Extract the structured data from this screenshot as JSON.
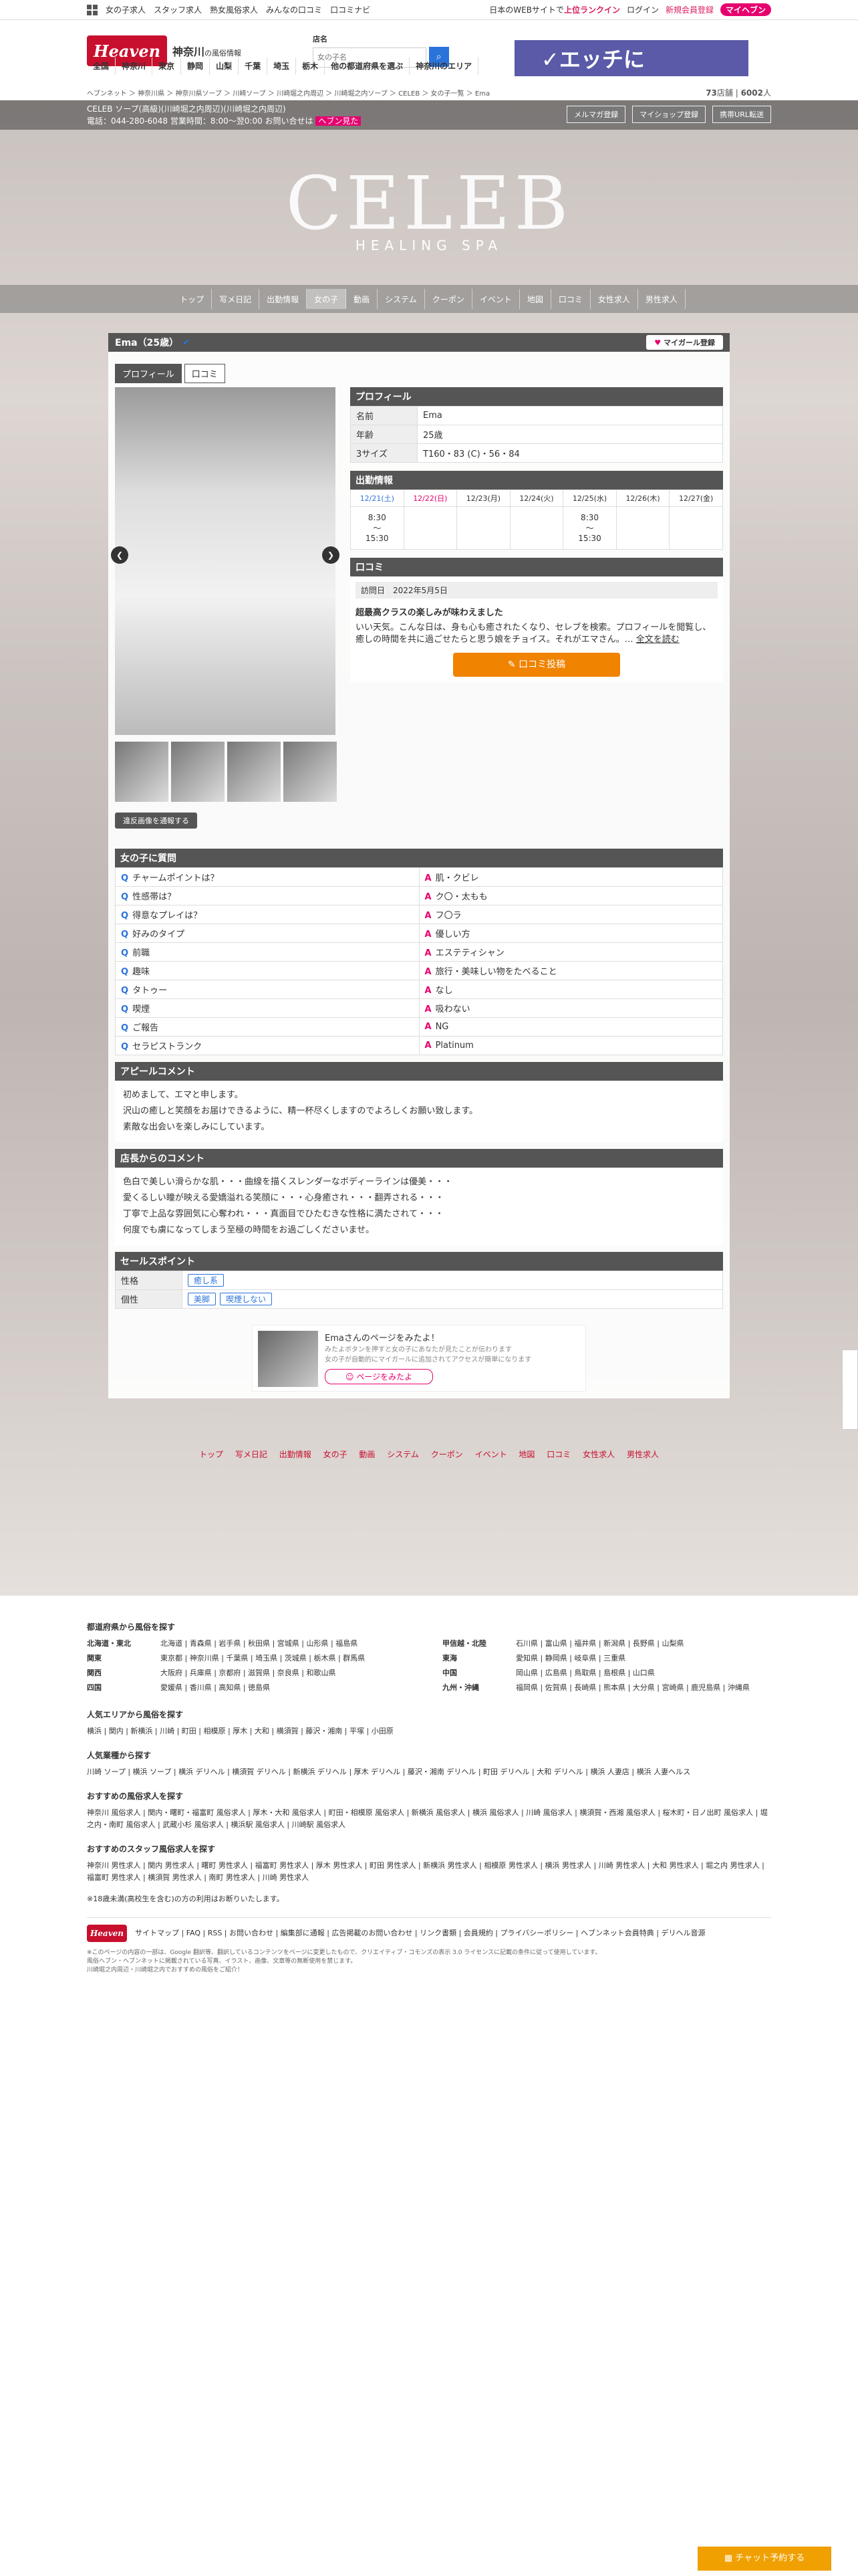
{
  "topbar": {
    "links": [
      "女の子求人",
      "スタッフ求人",
      "熟女風俗求人",
      "みんなの口コミ",
      "口コミナビ"
    ],
    "right": [
      "日本のWEBサイトで",
      "上位ランクイン",
      "ログイン",
      "新規会員登録"
    ],
    "mh": "マイヘブン"
  },
  "header": {
    "logo": "Heaven",
    "pref": "神奈川",
    "pref_sub": "の風俗情報",
    "search_label": "店名",
    "search_placeholder": "女の子名",
    "banner": "✓エッチに"
  },
  "nav": [
    "全国",
    "神奈川",
    "東京",
    "静岡",
    "山梨",
    "千葉",
    "埼玉",
    "栃木",
    "他の都道府県を選ぶ",
    "神奈川のエリア"
  ],
  "breadcrumb": {
    "path": "ヘブンネット ＞ 神奈川県 ＞ 神奈川県ソープ ＞ 川崎ソープ ＞ 川崎堀之内周辺 ＞ 川崎堀之内ソープ ＞ CELEB ＞ 女の子一覧 ＞ Ema",
    "count1": "73",
    "unit1": "店舗",
    "count2": "6002",
    "unit2": "人"
  },
  "store": {
    "line1": "CELEB ソープ(高級)(川崎堀之内周辺)(川崎堀之内周辺)",
    "line2": "電話：044-280-6048 営業時間：8:00〜翌0:00 お問い合せは",
    "heaven_note": "ヘブン見た",
    "buttons": [
      "メルマガ登録",
      "マイショップ登録",
      "携帯URL転送"
    ]
  },
  "brand": {
    "name": "CELEB",
    "sub": "HEALING SPA"
  },
  "shopnav": [
    "トップ",
    "写メ日記",
    "出勤情報",
    "女の子",
    "動画",
    "システム",
    "クーポン",
    "イベント",
    "地図",
    "口コミ",
    "女性求人",
    "男性求人"
  ],
  "girl": {
    "name": "Ema（25歳）",
    "mygirl": "マイガール登録",
    "tabs": [
      "プロフィール",
      "口コミ"
    ],
    "violation": "違反画像を通報する"
  },
  "profile": {
    "title": "プロフィール",
    "rows": [
      {
        "k": "名前",
        "v": "Ema"
      },
      {
        "k": "年齢",
        "v": "25歳"
      },
      {
        "k": "3サイズ",
        "v": "T160・83 (C)・56・84"
      }
    ]
  },
  "schedule": {
    "title": "出勤情報",
    "days": [
      "12/21(土)",
      "12/22(日)",
      "12/23(月)",
      "12/24(火)",
      "12/25(水)",
      "12/26(木)",
      "12/27(金)"
    ],
    "cells": [
      "8:30\n〜\n15:30",
      "",
      "",
      "",
      "8:30\n〜\n15:30",
      "",
      ""
    ]
  },
  "review": {
    "title": "口コミ",
    "date_label": "訪問日",
    "date": "2022年5月5日",
    "headline": "超最高クラスの楽しみが味わえました",
    "body": "いい天気。こんな日は、身も心も癒されたくなり、セレブを検索。プロフィールを閲覧し、癒しの時間を共に過ごせたらと思う娘をチョイス。それがエマさん。…",
    "more": "全文を読む",
    "button": "口コミ投稿"
  },
  "qa": {
    "title": "女の子に質問",
    "items": [
      {
        "q": "チャームポイントは？",
        "a": "肌・クビレ"
      },
      {
        "q": "性感帯は？",
        "a": "ク〇・太もも"
      },
      {
        "q": "得意なプレイは？",
        "a": "フ〇ラ"
      },
      {
        "q": "好みのタイプ",
        "a": "優しい方"
      },
      {
        "q": "前職",
        "a": "エステティシャン"
      },
      {
        "q": "趣味",
        "a": "旅行・美味しい物をたべること"
      },
      {
        "q": "タトゥー",
        "a": "なし"
      },
      {
        "q": "喫煙",
        "a": "吸わない"
      },
      {
        "q": "ご報告",
        "a": "NG"
      },
      {
        "q": "セラピストランク",
        "a": "Platinum"
      }
    ]
  },
  "appeal": {
    "title": "アピールコメント",
    "lines": [
      "初めまして、エマと申します。",
      "沢山の癒しと笑顔をお届けできるように、精一杯尽くしますのでよろしくお願い致します。",
      "素敵な出会いを楽しみにしています。"
    ]
  },
  "shopcomment": {
    "title": "店長からのコメント",
    "lines": [
      "色白で美しい滑らかな肌・・・曲線を描くスレンダーなボディーラインは優美・・・",
      "愛くるしい瞳が映える愛嬌溢れる笑顔に・・・心身癒され・・・翻弄される・・・",
      "丁寧で上品な雰囲気に心奪われ・・・真面目でひたむきな性格に満たされて・・・",
      "何度でも虜になってしまう至極の時間をお過ごしくださいませ。"
    ]
  },
  "sales": {
    "title": "セールスポイント",
    "rows": [
      {
        "k": "性格",
        "tags": [
          "癒し系"
        ]
      },
      {
        "k": "個性",
        "tags": [
          "美脚",
          "喫煙しない"
        ]
      }
    ]
  },
  "promo": {
    "line1": "Emaさんのページをみたよ！",
    "line2": "みたよボタンを押すと女の子にあなたが見たことが伝わります",
    "line3": "女の子が自動的にマイガールに追加されてアクセスが簡単になります",
    "btn": "ページをみたよ"
  },
  "bottomnav": [
    "トップ",
    "写メ日記",
    "出勤情報",
    "女の子",
    "動画",
    "システム",
    "クーポン",
    "イベント",
    "地図",
    "口コミ",
    "女性求人",
    "男性求人"
  ],
  "footer": {
    "title1": "都道府県から風俗を探す",
    "regions": [
      {
        "k": "北海道・東北",
        "v": "北海道 | 青森県 | 岩手県 | 秋田県 | 宮城県 | 山形県 | 福島県"
      },
      {
        "k": "関東",
        "v": "東京都 | 神奈川県 | 千葉県 | 埼玉県 | 茨城県 | 栃木県 | 群馬県"
      },
      {
        "k": "関西",
        "v": "大阪府 | 兵庫県 | 京都府 | 滋賀県 | 奈良県 | 和歌山県"
      },
      {
        "k": "四国",
        "v": "愛媛県 | 香川県 | 高知県 | 徳島県"
      }
    ],
    "regions2": [
      {
        "k": "甲信越・北陸",
        "v": "石川県 | 富山県 | 福井県 | 新潟県 | 長野県 | 山梨県"
      },
      {
        "k": "東海",
        "v": "愛知県 | 静岡県 | 岐阜県 | 三重県"
      },
      {
        "k": "中国",
        "v": "岡山県 | 広島県 | 鳥取県 | 島根県 | 山口県"
      },
      {
        "k": "九州・沖縄",
        "v": "福岡県 | 佐賀県 | 長崎県 | 熊本県 | 大分県 | 宮崎県 | 鹿児島県 | 沖縄県"
      }
    ],
    "title2": "人気エリアから風俗を探す",
    "area": "横浜 | 関内 | 新横浜 | 川崎 | 町田 | 相模原 | 厚木 | 大和 | 横須賀 | 藤沢・湘南 | 平塚 | 小田原",
    "title3": "人気業種から探す",
    "genre": "川崎 ソープ | 横浜 ソープ | 横浜 デリヘル | 横須賀 デリヘル | 新横浜 デリヘル | 厚木 デリヘル | 藤沢・湘南 デリヘル | 町田 デリヘル | 大和 デリヘル | 横浜 人妻店 | 横浜 人妻ヘルス",
    "title4": "おすすめの風俗求人を探す",
    "jobs": "神奈川 風俗求人 | 関内・曙町・福富町 風俗求人 | 厚木・大和 風俗求人 | 町田・相模原 風俗求人 | 新横浜 風俗求人 | 横浜 風俗求人 | 川崎 風俗求人 | 横須賀・西湘 風俗求人 | 桜木町・日ノ出町 風俗求人 | 堀之内・南町 風俗求人 | 武蔵小杉 風俗求人 | 横浜駅 風俗求人 | 川崎駅 風俗求人",
    "title5": "おすすめのスタッフ風俗求人を探す",
    "staff": "神奈川 男性求人 | 関内 男性求人 | 曙町 男性求人 | 福富町 男性求人 | 厚木 男性求人 | 町田 男性求人 | 新横浜 男性求人 | 相模原 男性求人 | 横浜 男性求人 | 川崎 男性求人 | 大和 男性求人 | 堀之内 男性求人 | 福富町 男性求人 | 横須賀 男性求人 | 南町 男性求人 | 川崎 男性求人",
    "age": "※18歳未満(高校生を含む)の方の利用はお断りいたします。",
    "links": "サイトマップ | FAQ | RSS | お問い合わせ | 編集部に通報 | 広告掲載のお問い合わせ | リンク書類 | 会員規約 | プライバシーポリシー | ヘブンネット会員特典 | デリヘル音源",
    "small": "※このページの内容の一部は、Google 翻訳等、翻訳しているコンテンツをページに変更したもので、クリエイティブ・コモンズの表示 3.0 ライセンスに記載の条件に従って使用しています。",
    "small2": "風俗ヘブン・ヘブンネットに掲載されている写真、イラスト、画像、文章等の無断使用を禁じます。",
    "small3": "川崎堀之内周辺・川崎堀之内でおすすめの風俗をご紹介！"
  },
  "chat": "チャット予約する"
}
